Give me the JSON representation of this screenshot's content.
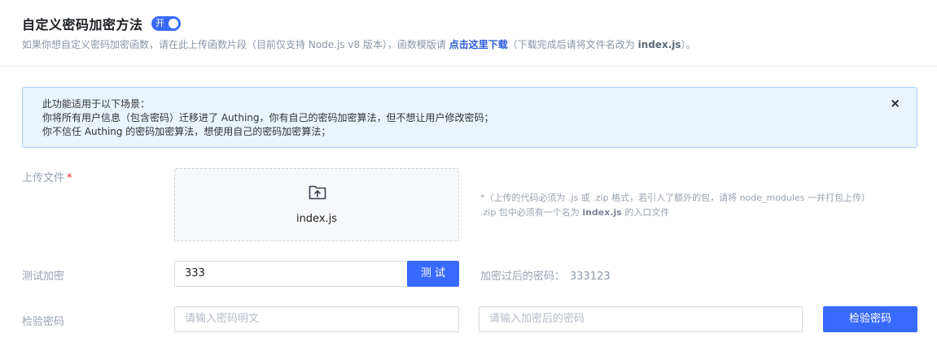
{
  "header": {
    "title": "自定义密码加密方法",
    "toggle_label": "开",
    "desc_prefix": "如果你想自定义密码加密函数，请在此上传函数片段（目前仅支持 Node.js v8 版本），函数模版请 ",
    "desc_link": "点击这里下载",
    "desc_mid": "（下载完成后请将文件名改为 ",
    "desc_file": "index.js",
    "desc_suffix": "）。"
  },
  "alert": {
    "line1": "此功能适用于以下场景：",
    "line2": "你将所有用户信息（包含密码）迁移进了 Authing，你有自己的密码加密算法，但不想让用户修改密码；",
    "line3": "你不信任 Authing 的密码加密算法，想使用自己的密码加密算法；",
    "close": "×"
  },
  "upload": {
    "label": "上传文件",
    "required_mark": "*",
    "file_name": "index.js",
    "icon": "folder-upload-icon",
    "hint_line1": "*（上传的代码必须为 .js 或 .zip 格式，若引入了额外的包，请将 node_modules 一并打包上传）",
    "hint_line2_prefix": ".zip 包中必须有一个名为 ",
    "hint_line2_file": "index.js",
    "hint_line2_suffix": " 的入口文件"
  },
  "test": {
    "label": "测试加密",
    "input_value": "333",
    "button": "测 试",
    "result_label": "加密过后的密码：",
    "result_value": "333123"
  },
  "verify": {
    "label": "检验密码",
    "plain_placeholder": "请输入密码明文",
    "encrypted_placeholder": "请输入加密后的密码",
    "button": "检验密码"
  },
  "colors": {
    "primary": "#396aff",
    "link": "#2a5bd7",
    "alert_bg": "#eaf4fe",
    "alert_border": "#a7d0f7",
    "required": "#f5222d"
  }
}
